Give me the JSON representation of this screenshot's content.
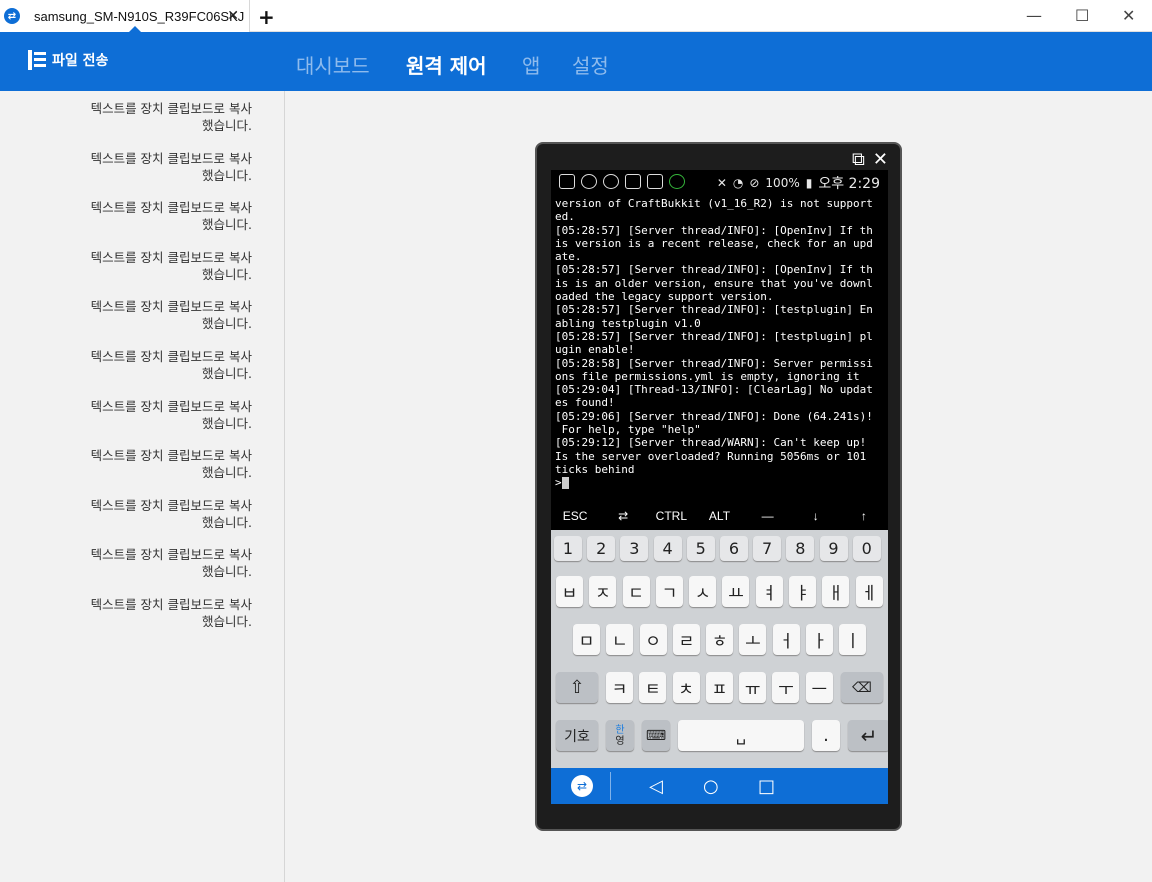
{
  "window": {
    "tab_title": "samsung_SM-N910S_R39FC06SKJ",
    "tab_close": "✕",
    "new_tab": "+",
    "minimize": "—",
    "maximize": "☐",
    "close": "✕"
  },
  "header": {
    "file_transfer_label": "파일 전송",
    "nav": [
      "대시보드",
      "원격 제어",
      "앱",
      "설정"
    ],
    "active_nav": "원격 제어"
  },
  "log": {
    "items": [
      {
        "line1": "텍스트를 장치 클립보드로 복사",
        "line2": "했습니다."
      },
      {
        "line1": "텍스트를 장치 클립보드로 복사",
        "line2": "했습니다."
      },
      {
        "line1": "텍스트를 장치 클립보드로 복사",
        "line2": "했습니다."
      },
      {
        "line1": "텍스트를 장치 클립보드로 복사",
        "line2": "했습니다."
      },
      {
        "line1": "텍스트를 장치 클립보드로 복사",
        "line2": "했습니다."
      },
      {
        "line1": "텍스트를 장치 클립보드로 복사",
        "line2": "했습니다."
      },
      {
        "line1": "텍스트를 장치 클립보드로 복사",
        "line2": "했습니다."
      },
      {
        "line1": "텍스트를 장치 클립보드로 복사",
        "line2": "했습니다."
      },
      {
        "line1": "텍스트를 장치 클립보드로 복사",
        "line2": "했습니다."
      },
      {
        "line1": "텍스트를 장치 클립보드로 복사",
        "line2": "했습니다."
      },
      {
        "line1": "텍스트를 장치 클립보드로 복사",
        "line2": "했습니다."
      }
    ]
  },
  "device": {
    "status": {
      "battery": "100%",
      "time": "오후 2:29"
    },
    "terminal_lines": [
      "version of CraftBukkit (v1_16_R2) is not support",
      "ed.",
      "[05:28:57] [Server thread/INFO]: [OpenInv] If th",
      "is version is a recent release, check for an upd",
      "ate.",
      "[05:28:57] [Server thread/INFO]: [OpenInv] If th",
      "is is an older version, ensure that you've downl",
      "oaded the legacy support version.",
      "[05:28:57] [Server thread/INFO]: [testplugin] En",
      "abling testplugin v1.0",
      "[05:28:57] [Server thread/INFO]: [testplugin] pl",
      "ugin enable!",
      "[05:28:58] [Server thread/INFO]: Server permissi",
      "ons file permissions.yml is empty, ignoring it",
      "[05:29:04] [Thread-13/INFO]: [ClearLag] No updat",
      "es found!",
      "[05:29:06] [Server thread/INFO]: Done (64.241s)!",
      " For help, type \"help\"",
      "[05:29:12] [Server thread/WARN]: Can't keep up!",
      "Is the server overloaded? Running 5056ms or 101",
      "ticks behind"
    ],
    "prompt": ">",
    "extra_keys": [
      "ESC",
      "⇄",
      "CTRL",
      "ALT",
      "—",
      "↓",
      "↑"
    ],
    "keyboard": {
      "numbers": [
        "1",
        "2",
        "3",
        "4",
        "5",
        "6",
        "7",
        "8",
        "9",
        "0"
      ],
      "row1": [
        "ㅂ",
        "ㅈ",
        "ㄷ",
        "ㄱ",
        "ㅅ",
        "ㅛ",
        "ㅕ",
        "ㅑ",
        "ㅐ",
        "ㅔ"
      ],
      "row2": [
        "ㅁ",
        "ㄴ",
        "ㅇ",
        "ㄹ",
        "ㅎ",
        "ㅗ",
        "ㅓ",
        "ㅏ",
        "ㅣ"
      ],
      "row3": [
        "ㅋ",
        "ㅌ",
        "ㅊ",
        "ㅍ",
        "ㅠ",
        "ㅜ",
        "ㅡ"
      ],
      "symbols_key": "기호",
      "lang_key_top": "한",
      "lang_key_bottom": "영",
      "period_key": "."
    }
  }
}
